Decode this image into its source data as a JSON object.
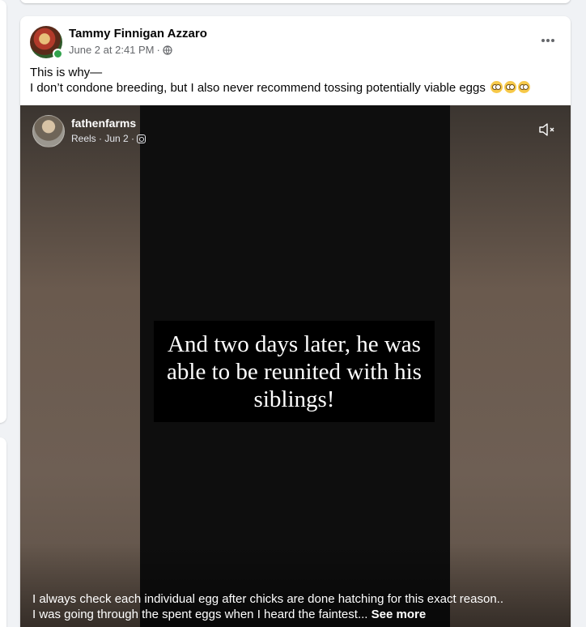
{
  "post": {
    "author": "Tammy Finnigan Azzaro",
    "timestamp": "June 2 at 2:41 PM",
    "separator": "·",
    "audience_icon": "globe-icon",
    "text_line1": "This is why—",
    "text_line2": "I don’t  condone breeding, but I also never recommend tossing potentially viable eggs",
    "emojis": [
      "pleading-face",
      "pleading-face",
      "pleading-face"
    ]
  },
  "reel": {
    "author": "fathenfarms",
    "meta": "Reels · Jun 2 ·",
    "source_icon": "instagram-icon",
    "caption": "And two days later, he was able to be reunited with his siblings!",
    "description_line1": "I always check each individual egg after chicks are done hatching for this exact reason..",
    "description_line2": "I was going through the spent eggs when I heard the faintest...",
    "see_more": "See more"
  },
  "colors": {
    "online": "#31a24c",
    "text_primary": "#050505",
    "text_secondary": "#65676b",
    "page_bg": "#f0f2f5"
  }
}
